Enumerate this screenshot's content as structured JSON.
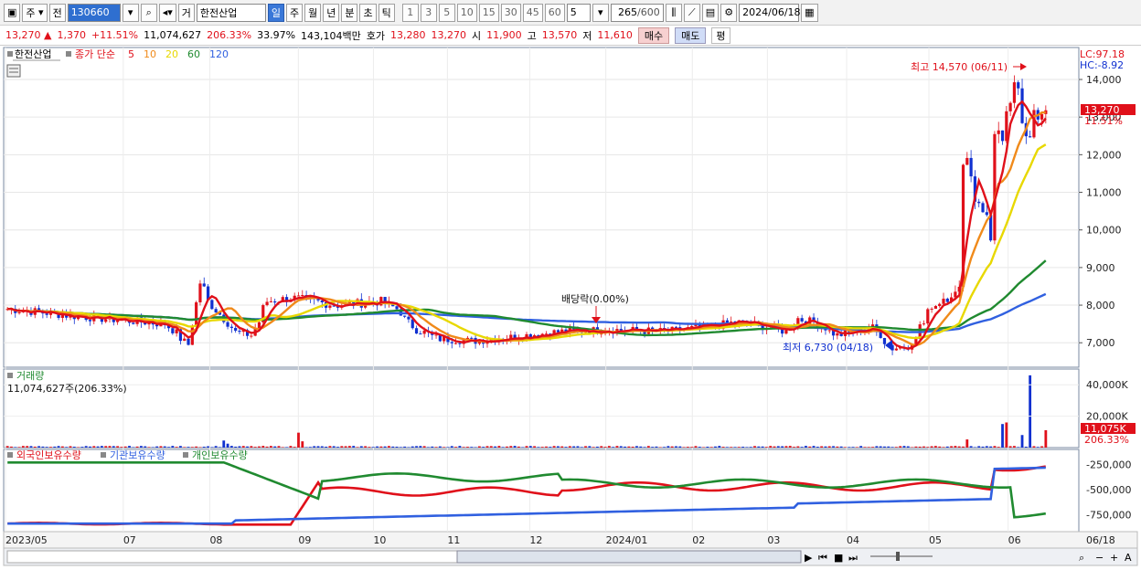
{
  "toolbar": {
    "market_type": "주",
    "prev_label": "전",
    "stock_code": "130660",
    "mode_label": "거",
    "stock_name": "한전산업",
    "period_tabs": [
      "일",
      "주",
      "월",
      "년",
      "분",
      "초",
      "틱"
    ],
    "active_period": "일",
    "intervals": [
      "1",
      "3",
      "5",
      "10",
      "15",
      "30",
      "45",
      "60"
    ],
    "interval_select": "5",
    "count": "265",
    "count_total": "/600",
    "date": "2024/06/18"
  },
  "quote": {
    "price": "13,270",
    "change": "1,370",
    "change_pct": "+11.51%",
    "volume": "11,074,627",
    "volume_ratio": "206.33%",
    "turnover": "33.97%",
    "amount": "143,104백만",
    "ask_label": "호가",
    "ask1": "13,280",
    "ask2": "13,270",
    "open_label": "시",
    "open": "11,900",
    "high_label": "고",
    "high": "13,570",
    "low_label": "저",
    "low": "11,610",
    "buy_label": "매수",
    "sell_label": "매도",
    "eval_label": "평"
  },
  "chart": {
    "stock_label": "한전산업",
    "ma_label": "종가 단순",
    "ma_periods": [
      {
        "label": "5",
        "color": "#e0101a"
      },
      {
        "label": "10",
        "color": "#f08a1a"
      },
      {
        "label": "20",
        "color": "#e8d800"
      },
      {
        "label": "60",
        "color": "#208a30"
      },
      {
        "label": "120",
        "color": "#3060e0"
      }
    ],
    "lc_label": "LC:97.18",
    "hc_label": "HC:-8.92",
    "max_annotation": "최고 14,570 (06/11)",
    "min_annotation": "최저 6,730 (04/18)",
    "dividend_annotation": "배당락(0.00%)",
    "price_axis": [
      "14,000",
      "13,000",
      "12,000",
      "11,000",
      "10,000",
      "9,000",
      "8,000",
      "7,000"
    ],
    "current_price_tag": "13,270",
    "current_pct_tag": "11.51%",
    "volume_title": "거래량",
    "volume_value": "11,074,627주(206.33%)",
    "volume_axis": [
      "40,000K",
      "20,000K"
    ],
    "volume_tag": "11,075K",
    "volume_pct_tag": "206.33%",
    "holder_labels": [
      {
        "label": "외국인보유수량",
        "color": "#e0101a"
      },
      {
        "label": "기관보유수량",
        "color": "#3060e0"
      },
      {
        "label": "개인보유수량",
        "color": "#208a30"
      }
    ],
    "holder_axis": [
      "-250,000",
      "-500,000",
      "-750,000"
    ],
    "date_axis": [
      "2023/05",
      "07",
      "08",
      "09",
      "10",
      "11",
      "12",
      "2024/01",
      "02",
      "03",
      "04",
      "05",
      "06"
    ],
    "date_last": "06/18"
  },
  "colors": {
    "up": "#e0101a",
    "down": "#1030d0",
    "ma5": "#e0101a",
    "ma10": "#f08a1a",
    "ma20": "#e8d800",
    "ma60": "#208a30",
    "ma120": "#3060e0"
  }
}
